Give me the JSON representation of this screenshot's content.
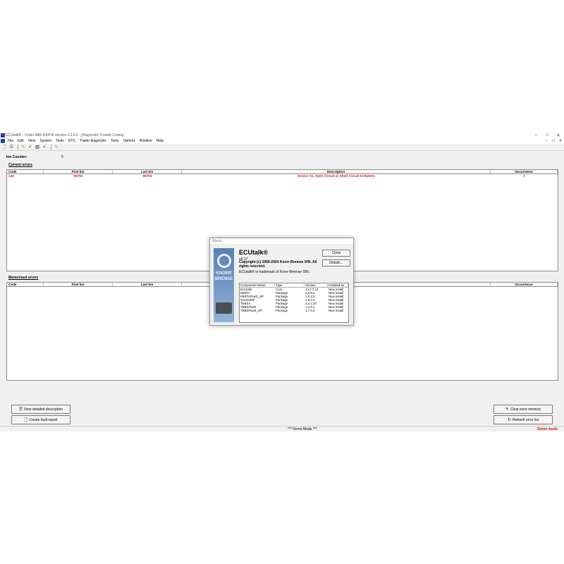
{
  "window": {
    "title": "ECUtalk® - Trailer ABS KB4TA Version 2.3.8.0 - [Diagnostic Trouble Codes]",
    "controls": [
      "–",
      "□",
      "✕"
    ]
  },
  "menu": [
    "File",
    "Edit",
    "View",
    "System",
    "Tests",
    "DTC",
    "Trailer diagnostic",
    "Tools",
    "Options",
    "Window",
    "Help"
  ],
  "km_counter": {
    "label": "km Counter:",
    "value": "0"
  },
  "current_errors": {
    "title": "Current errors",
    "columns": [
      "Code",
      "First km",
      "Last km",
      "Description",
      "Occurrence"
    ],
    "rows": [
      {
        "code": "143",
        "first_km": "65793",
        "last_km": "65793",
        "description": "Sensor S1, Open Circuit or Short Circuit to Battery",
        "occurrence": "1"
      }
    ]
  },
  "memorised_errors": {
    "title": "Memorised errors",
    "columns": [
      "Code",
      "First km",
      "Last km",
      "Description",
      "Occurrence"
    ]
  },
  "buttons": {
    "view_desc": "View detailed description",
    "create_report": "Create fault report",
    "clear_memory": "Clear error memory",
    "refresh": "Refresh error list"
  },
  "status": {
    "center": "*** Demo Mode ***",
    "right": "Demo mode"
  },
  "about": {
    "title": "About",
    "app_name": "ECUtalk®",
    "version": "v4.17",
    "copyright": "Copyright (c) 1999-2004 Knorr-Bremse SfN. All rights reserved.",
    "trademark": "ECUtalk® is trademark of Knorr-Bremse SfN.",
    "close": "Close",
    "details": "Details...",
    "logo_text_1": "KNORR",
    "logo_text_2": "BREMSE",
    "columns": [
      "Component Name",
      "Type",
      "Version",
      "Installed as"
    ],
    "components": [
      {
        "name": "ECUtalk",
        "type": "Core",
        "version": "4.17.7.13",
        "installed": "New install"
      },
      {
        "name": "KB4TA",
        "type": "Package",
        "version": "2.3.8.0",
        "installed": "New install"
      },
      {
        "name": "KB4TAFlash_UP",
        "type": "Package",
        "version": "1.0.2.0",
        "installed": "New install"
      },
      {
        "name": "SvcDUDIF",
        "type": "Package",
        "version": "1.8.0.2",
        "installed": "New install"
      },
      {
        "name": "TEBS4",
        "type": "Package",
        "version": "3.3.1.10",
        "installed": "New install"
      },
      {
        "name": "TEBSFlash",
        "type": "Package",
        "version": "1.4.3.1",
        "installed": "New install"
      },
      {
        "name": "TEBSFlash_UP",
        "type": "Package",
        "version": "1.7.0.0",
        "installed": "New install"
      }
    ]
  }
}
